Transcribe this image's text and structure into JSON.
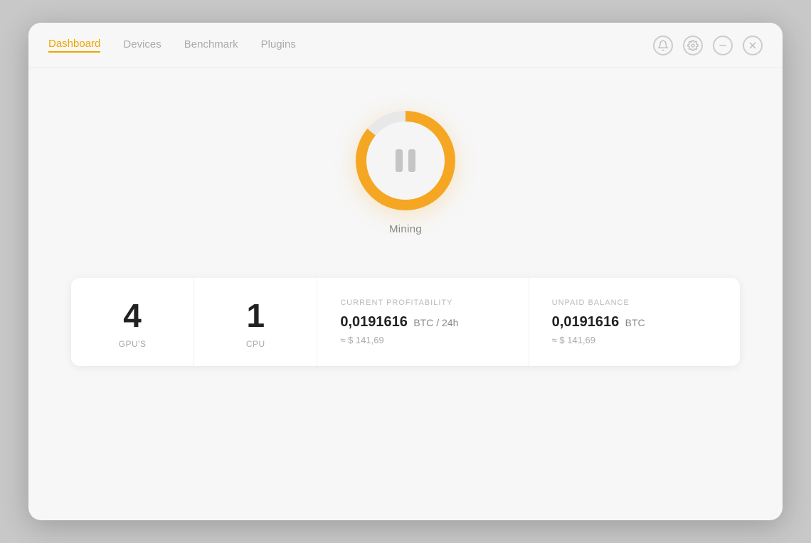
{
  "nav": {
    "items": [
      {
        "label": "Dashboard",
        "active": true
      },
      {
        "label": "Devices",
        "active": false
      },
      {
        "label": "Benchmark",
        "active": false
      },
      {
        "label": "Plugins",
        "active": false
      }
    ]
  },
  "window_controls": {
    "bell_label": "notifications",
    "settings_label": "settings",
    "minimize_label": "minimize",
    "close_label": "close"
  },
  "mining": {
    "state_label": "Mining",
    "button_title": "Pause/Resume Mining"
  },
  "stats": {
    "gpu": {
      "value": "4",
      "label": "GPU'S"
    },
    "cpu": {
      "value": "1",
      "label": "CPU"
    },
    "profitability": {
      "title": "CURRENT PROFITABILITY",
      "value": "0,0191616",
      "unit": "BTC / 24h",
      "sub": "≈ $ 141,69"
    },
    "balance": {
      "title": "UNPAID BALANCE",
      "value": "0,0191616",
      "unit": "BTC",
      "sub": "≈ $ 141,69"
    }
  }
}
